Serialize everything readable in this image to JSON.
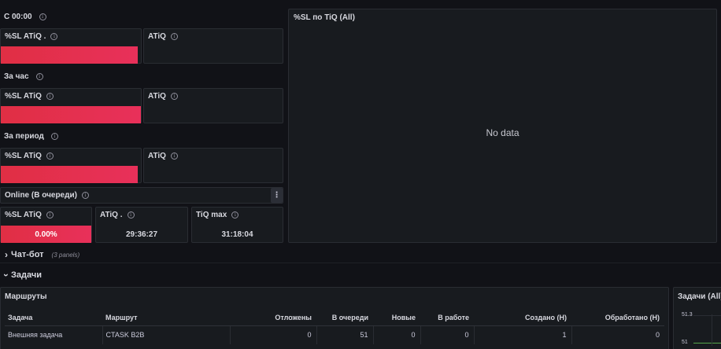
{
  "section_today": {
    "title": "С 00:00",
    "sl_title": "%SL ATiQ .",
    "atiq_title": "ATiQ"
  },
  "section_hour": {
    "title": "За час",
    "sl_title": "%SL ATiQ",
    "atiq_title": "ATiQ"
  },
  "section_period": {
    "title": "За период",
    "sl_title": "%SL ATiQ",
    "atiq_title": "ATiQ"
  },
  "online": {
    "title": "Online (В очереди)",
    "menu": "⋮",
    "sl_title": "%SL ATiQ",
    "sl_value": "0.00%",
    "atiq_title": "ATiQ .",
    "atiq_value": "29:36:27",
    "tiq_title": "TiQ max",
    "tiq_value": "31:18:04"
  },
  "sl_chart": {
    "title": "%SL по TiQ (All)",
    "empty_text": "No data"
  },
  "chatbot_row": {
    "chevron": "›",
    "title": "Чат-бот",
    "count": "(3 panels)"
  },
  "tasks_row": {
    "chevron": "›",
    "title": "Задачи"
  },
  "routes_table": {
    "title": "Маршруты",
    "columns": [
      "Задача",
      "Маршрут",
      "Отложены",
      "В очереди",
      "Новые",
      "В работе",
      "Создано (Н)",
      "Обработано (Н)"
    ],
    "rows": [
      [
        "Внешняя задача",
        "CTASK B2B",
        "0",
        "51",
        "0",
        "0",
        "1",
        "0"
      ]
    ]
  },
  "tasks_graph": {
    "title": "Задачи (All)",
    "ticks": [
      "51.3",
      "51"
    ]
  },
  "colors": {
    "background": "#111217",
    "panel": "#181b1f",
    "critical": "#e02f44"
  },
  "icons": {
    "info": "info-icon",
    "menu": "menu-icon",
    "chevron": "chevron-icon"
  }
}
